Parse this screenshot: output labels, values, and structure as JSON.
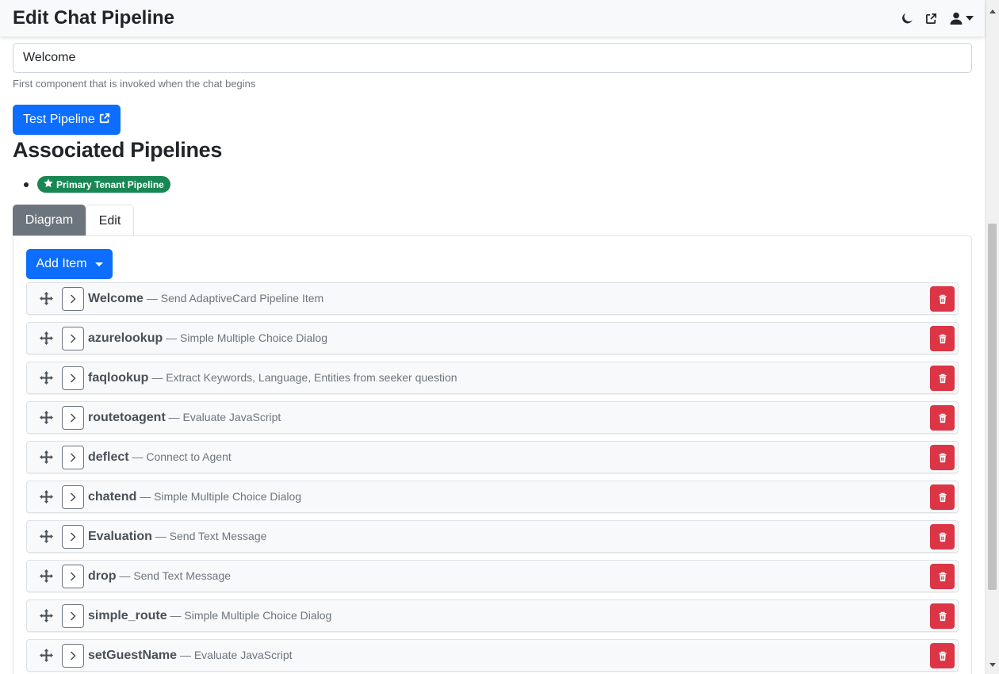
{
  "header": {
    "title": "Edit Chat Pipeline"
  },
  "form": {
    "start_component_value": "Welcome",
    "start_component_help": "First component that is invoked when the chat begins",
    "test_button_label": "Test Pipeline"
  },
  "associated": {
    "title": "Associated Pipelines",
    "badges": [
      {
        "label": "Primary Tenant Pipeline",
        "color": "#198754"
      }
    ]
  },
  "tabs": [
    {
      "label": "Diagram",
      "active": true
    },
    {
      "label": "Edit",
      "active": false
    }
  ],
  "editor": {
    "add_button_label": "Add Item",
    "items": [
      {
        "name": "Welcome",
        "type": "— Send AdaptiveCard Pipeline Item"
      },
      {
        "name": "azurelookup",
        "type": "— Simple Multiple Choice Dialog"
      },
      {
        "name": "faqlookup",
        "type": "— Extract Keywords, Language, Entities from seeker question"
      },
      {
        "name": "routetoagent",
        "type": "— Evaluate JavaScript"
      },
      {
        "name": "deflect",
        "type": "— Connect to Agent"
      },
      {
        "name": "chatend",
        "type": "— Simple Multiple Choice Dialog"
      },
      {
        "name": "Evaluation",
        "type": "— Send Text Message"
      },
      {
        "name": "drop",
        "type": "— Send Text Message"
      },
      {
        "name": "simple_route",
        "type": "— Simple Multiple Choice Dialog"
      },
      {
        "name": "setGuestName",
        "type": "— Evaluate JavaScript"
      }
    ]
  },
  "colors": {
    "primary": "#0d6efd",
    "secondary": "#6c757d",
    "danger": "#dc3545",
    "success": "#198754"
  },
  "icons": {
    "theme": "moon-icon",
    "open": "external-link-icon",
    "user": "user-icon",
    "drag": "move-icon",
    "expand": "chevron-right-icon",
    "delete": "trash-icon",
    "badge": "star-icon"
  }
}
